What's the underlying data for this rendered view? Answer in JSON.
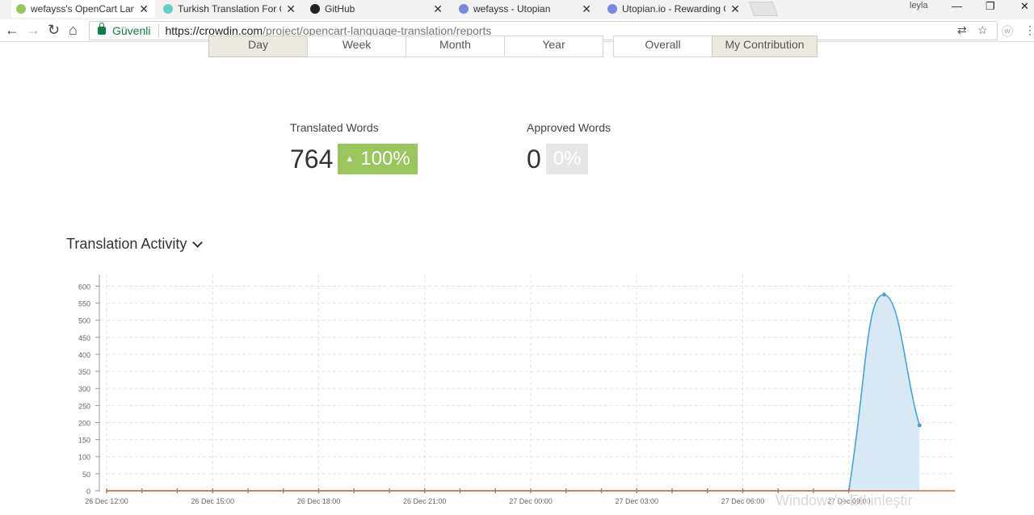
{
  "browser": {
    "tabs": [
      {
        "label": "wefayss's OpenCart Lang",
        "icon": "crowdin-icon",
        "active": true
      },
      {
        "label": "Turkish Translation For O",
        "icon": "utopian-icon",
        "active": false
      },
      {
        "label": "GitHub",
        "icon": "github-icon",
        "active": false
      },
      {
        "label": "wefayss - Utopian",
        "icon": "utopian-icon",
        "active": false
      },
      {
        "label": "Utopian.io - Rewarding C",
        "icon": "utopian-icon",
        "active": false
      }
    ],
    "user": "leyla",
    "secure_label": "Güvenli",
    "url_host": "https://crowdin.com",
    "url_path": "/project/opencart-language-translation/reports"
  },
  "period_tabs": [
    "Day",
    "Week",
    "Month",
    "Year"
  ],
  "scope_tabs": [
    "Overall",
    "My Contribution"
  ],
  "stats": {
    "translated": {
      "label": "Translated Words",
      "value": "764",
      "badge": "100%"
    },
    "approved": {
      "label": "Approved Words",
      "value": "0",
      "badge": "0%"
    }
  },
  "section_title": "Translation Activity",
  "watermark": "Windows'u Etkinleştir",
  "chart_data": {
    "type": "area",
    "x_ticks": [
      "26 Dec 12:00",
      "26 Dec 15:00",
      "26 Dec 18:00",
      "26 Dec 21:00",
      "27 Dec 00:00",
      "27 Dec 03:00",
      "27 Dec 06:00",
      "27 Dec 09:00"
    ],
    "y_ticks": [
      0,
      50,
      100,
      150,
      200,
      250,
      300,
      350,
      400,
      450,
      500,
      550,
      600
    ],
    "ylim": [
      0,
      620
    ],
    "x_hours": [
      0,
      1,
      2,
      3,
      4,
      5,
      6,
      7,
      8,
      9,
      10,
      11,
      12,
      13,
      14,
      15,
      16,
      17,
      18,
      19,
      20,
      21,
      22,
      23
    ],
    "series": [
      {
        "values": [
          0,
          0,
          0,
          0,
          0,
          0,
          0,
          0,
          0,
          0,
          0,
          0,
          0,
          0,
          0,
          0,
          0,
          0,
          0,
          0,
          0,
          0,
          575,
          192
        ]
      }
    ],
    "colors": {
      "line": "#4aa3d6",
      "fill": "#d7e9f7",
      "baseline": "#c0714a"
    }
  }
}
